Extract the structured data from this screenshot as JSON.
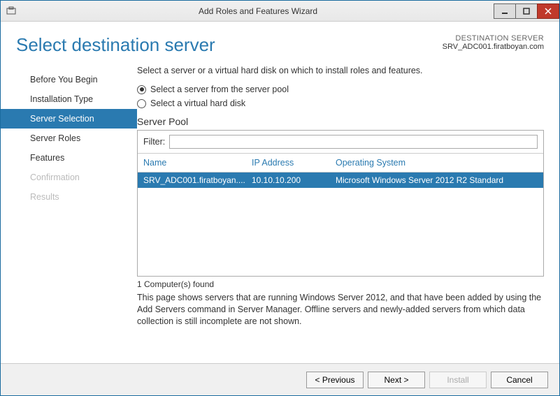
{
  "titlebar": {
    "title": "Add Roles and Features Wizard"
  },
  "header": {
    "page_title": "Select destination server",
    "dest_label": "DESTINATION SERVER",
    "dest_name": "SRV_ADC001.firatboyan.com"
  },
  "sidebar": {
    "items": [
      {
        "label": "Before You Begin",
        "state": "normal"
      },
      {
        "label": "Installation Type",
        "state": "normal"
      },
      {
        "label": "Server Selection",
        "state": "active"
      },
      {
        "label": "Server Roles",
        "state": "normal"
      },
      {
        "label": "Features",
        "state": "normal"
      },
      {
        "label": "Confirmation",
        "state": "disabled"
      },
      {
        "label": "Results",
        "state": "disabled"
      }
    ]
  },
  "main": {
    "intro": "Select a server or a virtual hard disk on which to install roles and features.",
    "radio1": "Select a server from the server pool",
    "radio2": "Select a virtual hard disk",
    "pool_label": "Server Pool",
    "filter_label": "Filter:",
    "filter_value": "",
    "columns": {
      "name": "Name",
      "ip": "IP Address",
      "os": "Operating System"
    },
    "rows": [
      {
        "name": "SRV_ADC001.firatboyan....",
        "ip": "10.10.10.200",
        "os": "Microsoft Windows Server 2012 R2 Standard"
      }
    ],
    "count": "1 Computer(s) found",
    "note": "This page shows servers that are running Windows Server 2012, and that have been added by using the Add Servers command in Server Manager. Offline servers and newly-added servers from which data collection is still incomplete are not shown."
  },
  "footer": {
    "previous": "< Previous",
    "next": "Next >",
    "install": "Install",
    "cancel": "Cancel"
  }
}
